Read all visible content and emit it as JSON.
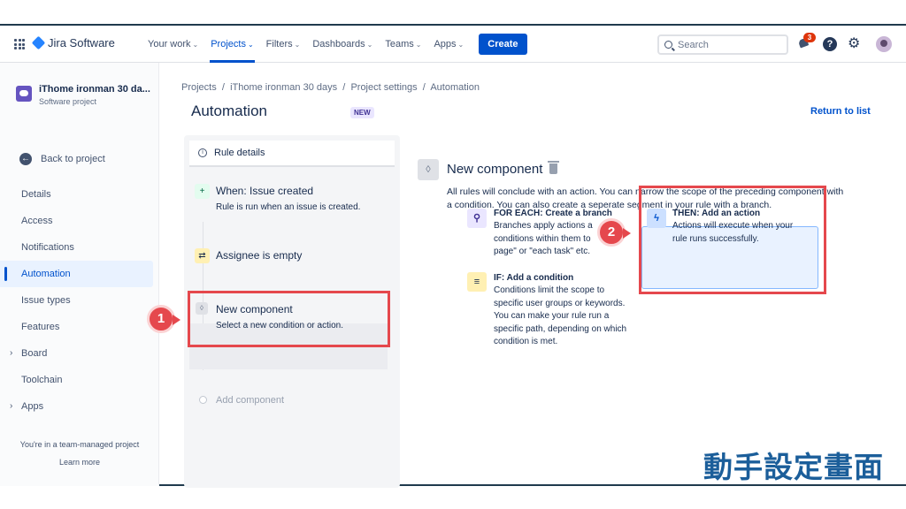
{
  "topnav": {
    "product": "Jira Software",
    "items": [
      {
        "label": "Your work",
        "active": false
      },
      {
        "label": "Projects",
        "active": true
      },
      {
        "label": "Filters",
        "active": false
      },
      {
        "label": "Dashboards",
        "active": false
      },
      {
        "label": "Teams",
        "active": false
      },
      {
        "label": "Apps",
        "active": false
      }
    ],
    "create_label": "Create",
    "search_placeholder": "Search",
    "notification_count": "3",
    "help_icon": "?",
    "colors": {
      "accent": "#0052cc",
      "badge": "#de350b"
    }
  },
  "sidebar": {
    "project_name": "iThome ironman 30 da...",
    "project_type": "Software project",
    "back_label": "Back to project",
    "items": [
      {
        "label": "Details",
        "expandable": false,
        "active": false
      },
      {
        "label": "Access",
        "expandable": false,
        "active": false
      },
      {
        "label": "Notifications",
        "expandable": false,
        "active": false
      },
      {
        "label": "Automation",
        "expandable": false,
        "active": true
      },
      {
        "label": "Issue types",
        "expandable": false,
        "active": false
      },
      {
        "label": "Features",
        "expandable": false,
        "active": false
      },
      {
        "label": "Board",
        "expandable": true,
        "active": false
      },
      {
        "label": "Toolchain",
        "expandable": false,
        "active": false
      },
      {
        "label": "Apps",
        "expandable": true,
        "active": false
      }
    ],
    "footer_text": "You're in a team-managed project",
    "learn_more": "Learn more"
  },
  "breadcrumb": [
    "Projects",
    "iThome ironman 30 days",
    "Project settings",
    "Automation"
  ],
  "breadcrumb_sep": "/",
  "page": {
    "title": "Automation",
    "new_badge": "NEW",
    "return_link": "Return to list"
  },
  "rule": {
    "details_label": "Rule details",
    "trigger_title": "When: Issue created",
    "trigger_sub": "Rule is run when an issue is created.",
    "condition_title": "Assignee is empty",
    "new_title": "New component",
    "new_sub": "Select a new condition or action.",
    "add_component": "Add component"
  },
  "component": {
    "title": "New component",
    "description": "All rules will conclude with an action. You can narrow the scope of the preceding component with a condition. You can also create a seperate segment in your rule with a branch.",
    "options": [
      {
        "title": "FOR EACH: Create a branch",
        "text": "Branches apply actions a conditions within them to page\" or \"each task\" etc.",
        "icon": "branch-icon"
      },
      {
        "title": "IF: Add a condition",
        "text": "Conditions limit the scope to specific user groups or keywords. You can make your rule run a specific path, depending on which condition is met.",
        "icon": "filter-icon"
      },
      {
        "title": "THEN: Add an action",
        "text": "Actions will execute when your rule runs successfully.",
        "icon": "lightning-icon"
      }
    ]
  },
  "annotations": {
    "marker_1": "1",
    "marker_2": "2",
    "caption": "動手設定畫面",
    "highlight_color": "#e5484d"
  }
}
